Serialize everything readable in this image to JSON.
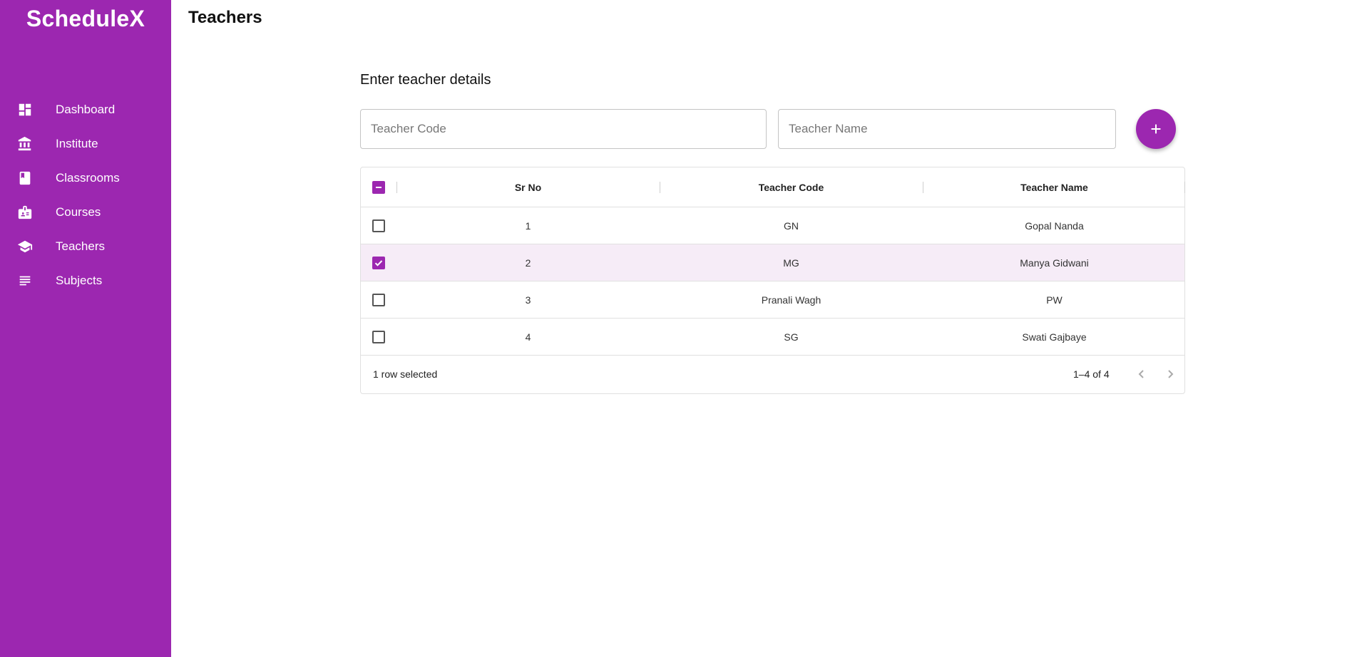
{
  "app": {
    "brand": "ScheduleX"
  },
  "sidebar": {
    "items": [
      {
        "label": "Dashboard",
        "icon": "dashboard-icon"
      },
      {
        "label": "Institute",
        "icon": "institution-icon"
      },
      {
        "label": "Classrooms",
        "icon": "book-icon"
      },
      {
        "label": "Courses",
        "icon": "badge-icon"
      },
      {
        "label": "Teachers",
        "icon": "school-icon"
      },
      {
        "label": "Subjects",
        "icon": "subject-lines-icon"
      }
    ]
  },
  "header": {
    "title": "Teachers"
  },
  "form": {
    "title": "Enter teacher details",
    "code_placeholder": "Teacher Code",
    "name_placeholder": "Teacher Name",
    "add_icon": "plus-icon"
  },
  "table": {
    "columns": [
      "Sr No",
      "Teacher Code",
      "Teacher Name"
    ],
    "rows": [
      {
        "sr": "1",
        "code": "GN",
        "name": "Gopal Nanda",
        "selected": false
      },
      {
        "sr": "2",
        "code": "MG",
        "name": "Manya Gidwani",
        "selected": true
      },
      {
        "sr": "3",
        "code": "Pranali Wagh",
        "name": "PW",
        "selected": false
      },
      {
        "sr": "4",
        "code": "SG",
        "name": "Swati Gajbaye",
        "selected": false
      }
    ],
    "footer": {
      "selection": "1 row selected",
      "range": "1–4 of 4"
    }
  },
  "colors": {
    "accent": "#9c27b0",
    "selected_row": "#f6ecf7"
  }
}
